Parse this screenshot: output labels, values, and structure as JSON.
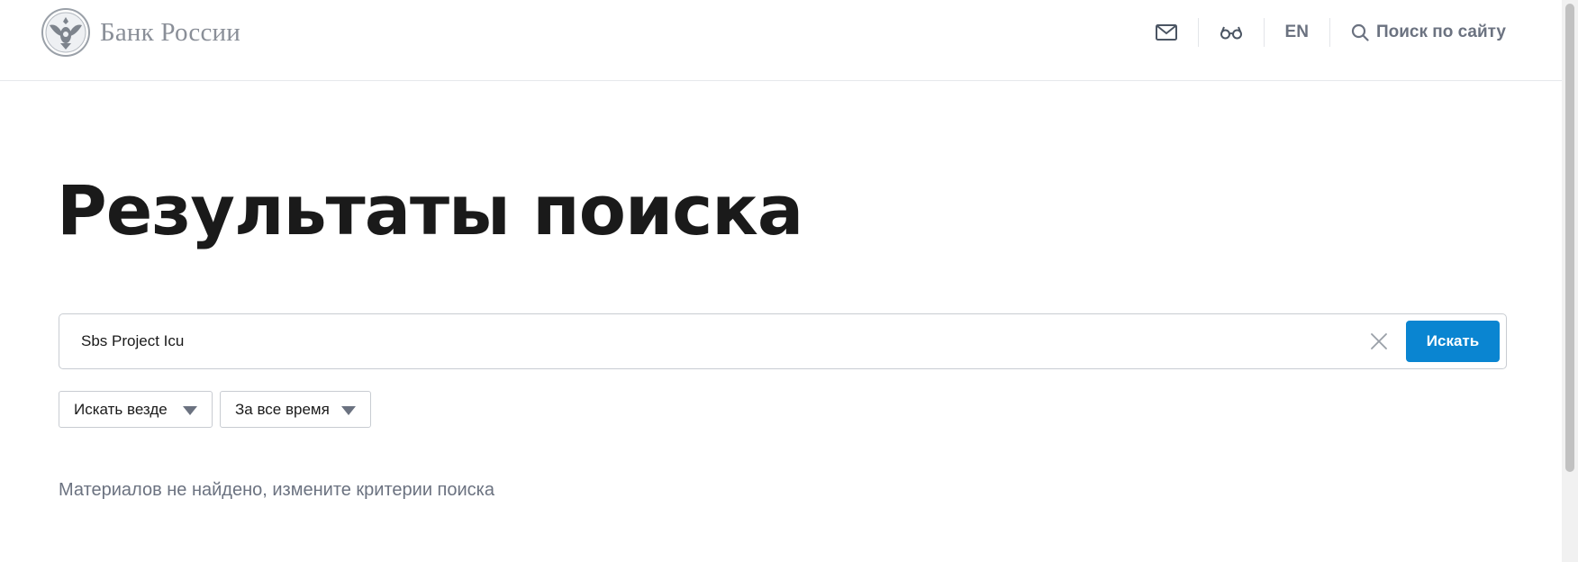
{
  "header": {
    "logo_text": "Банк России",
    "lang_label": "EN",
    "search_label": "Поиск по сайту"
  },
  "main": {
    "title": "Результаты поиска",
    "search": {
      "value": "Sbs Project Icu",
      "button_label": "Искать"
    },
    "filters": [
      {
        "label": "Искать везде"
      },
      {
        "label": "За все время"
      }
    ],
    "no_results_text": "Материалов не найдено, измените критерии поиска"
  },
  "colors": {
    "accent": "#0a85d1",
    "muted_text": "#6b7280",
    "title_text": "#1a1a1a"
  },
  "icons": [
    "bank-emblem-icon",
    "mail-icon",
    "glasses-icon",
    "search-icon",
    "close-icon",
    "chevron-down-icon"
  ]
}
